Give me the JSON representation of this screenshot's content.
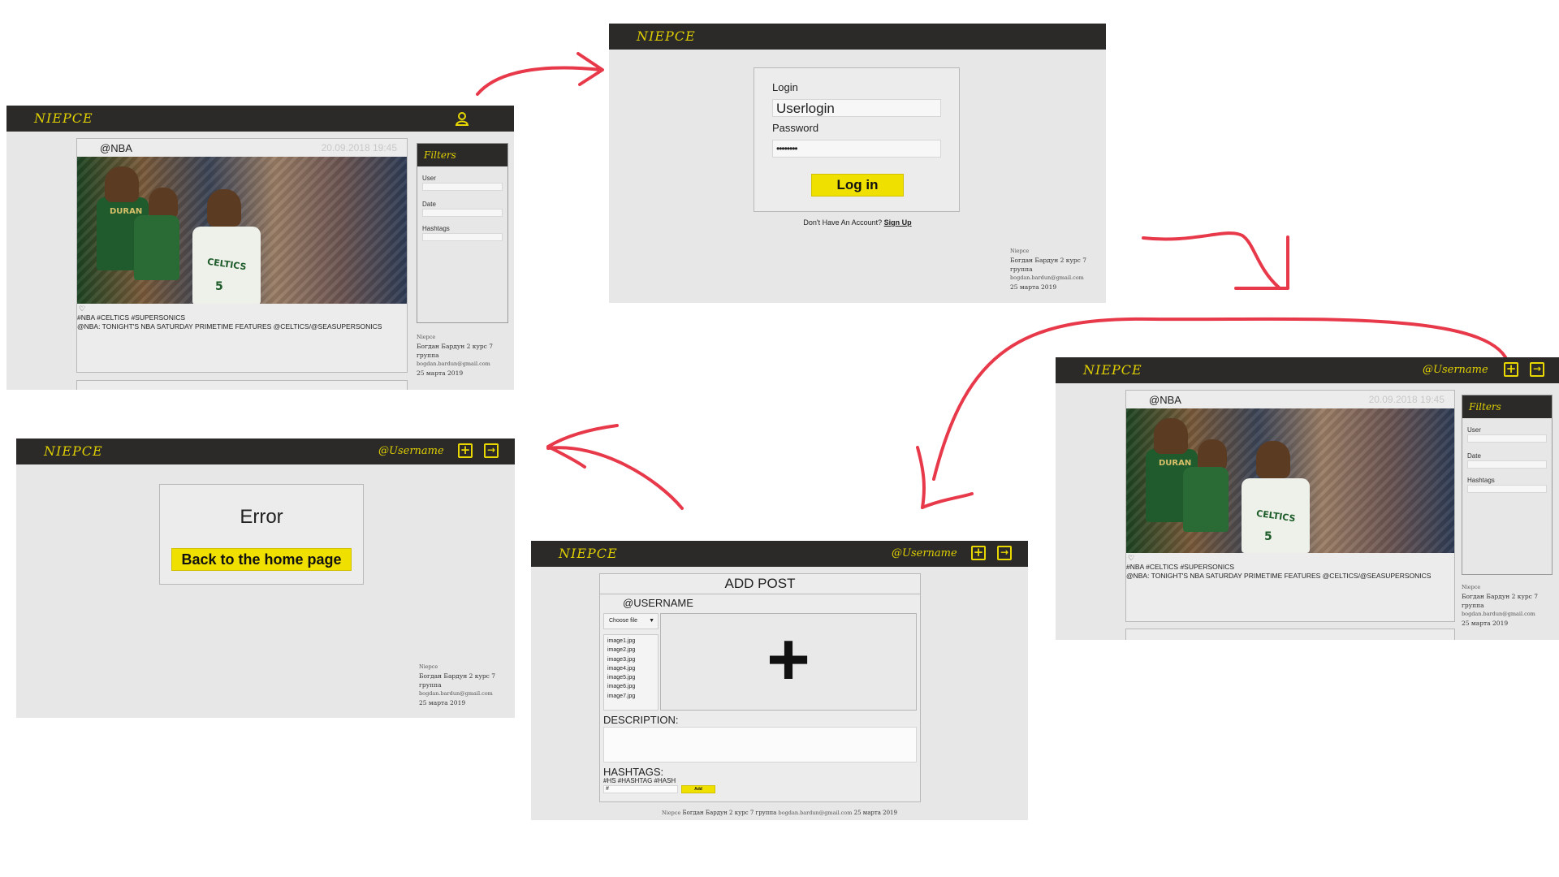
{
  "brand": "NIEPCE",
  "user_handle": "@Username",
  "post": {
    "user": "@NBA",
    "date": "20.09.2018 19:45",
    "tags": "#NBA #CELTICS #SUPERSONICS",
    "caption": "@NBA: TONIGHT'S NBA SATURDAY PRIMETIME FEATURES @CELTICS/@SEASUPERSONICS",
    "jersey_left": "DURAN",
    "jersey_right": "CELTICS",
    "jersey_number": "5"
  },
  "filters": {
    "title": "Filters",
    "user_label": "User",
    "date_label": "Date",
    "hashtags_label": "Hashtags"
  },
  "footer": {
    "name": "Niepce",
    "author": "Богдан Бардун 2 курс 7",
    "group": "группа",
    "email": "bogdan.bardun@gmail.com",
    "date": "25 марта 2019",
    "oneline": "Богдан Бардун 2 курс 7 группа"
  },
  "login": {
    "login_label": "Login",
    "login_value": "Userlogin",
    "password_label": "Password",
    "password_value": "••••••••",
    "button": "Log in",
    "no_account": "Don't Have An Account?",
    "signup": "Sign Up"
  },
  "add_post": {
    "title": "ADD POST",
    "username": "@USERNAME",
    "choose_file": "Choose file",
    "files": [
      "image1.jpg",
      "image2.jpg",
      "image3.jpg",
      "image4.jpg",
      "image5.jpg",
      "image6.jpg",
      "image7.jpg"
    ],
    "plus": "+",
    "description_label": "DESCRIPTION:",
    "hashtags_label": "HASHTAGS:",
    "hashtags_value": "#HS #HASHTAG #HASH",
    "hash_input": "#",
    "add_button": "Add"
  },
  "error": {
    "title": "Error",
    "button": "Back to the home page"
  },
  "colors": {
    "topbar": "#2b2a29",
    "accent": "#f0e000",
    "arrow": "#e8394a",
    "screen_bg": "#e7e7e7"
  },
  "icons": [
    "user-icon",
    "add-post-icon",
    "logout-icon",
    "heart-icon"
  ]
}
